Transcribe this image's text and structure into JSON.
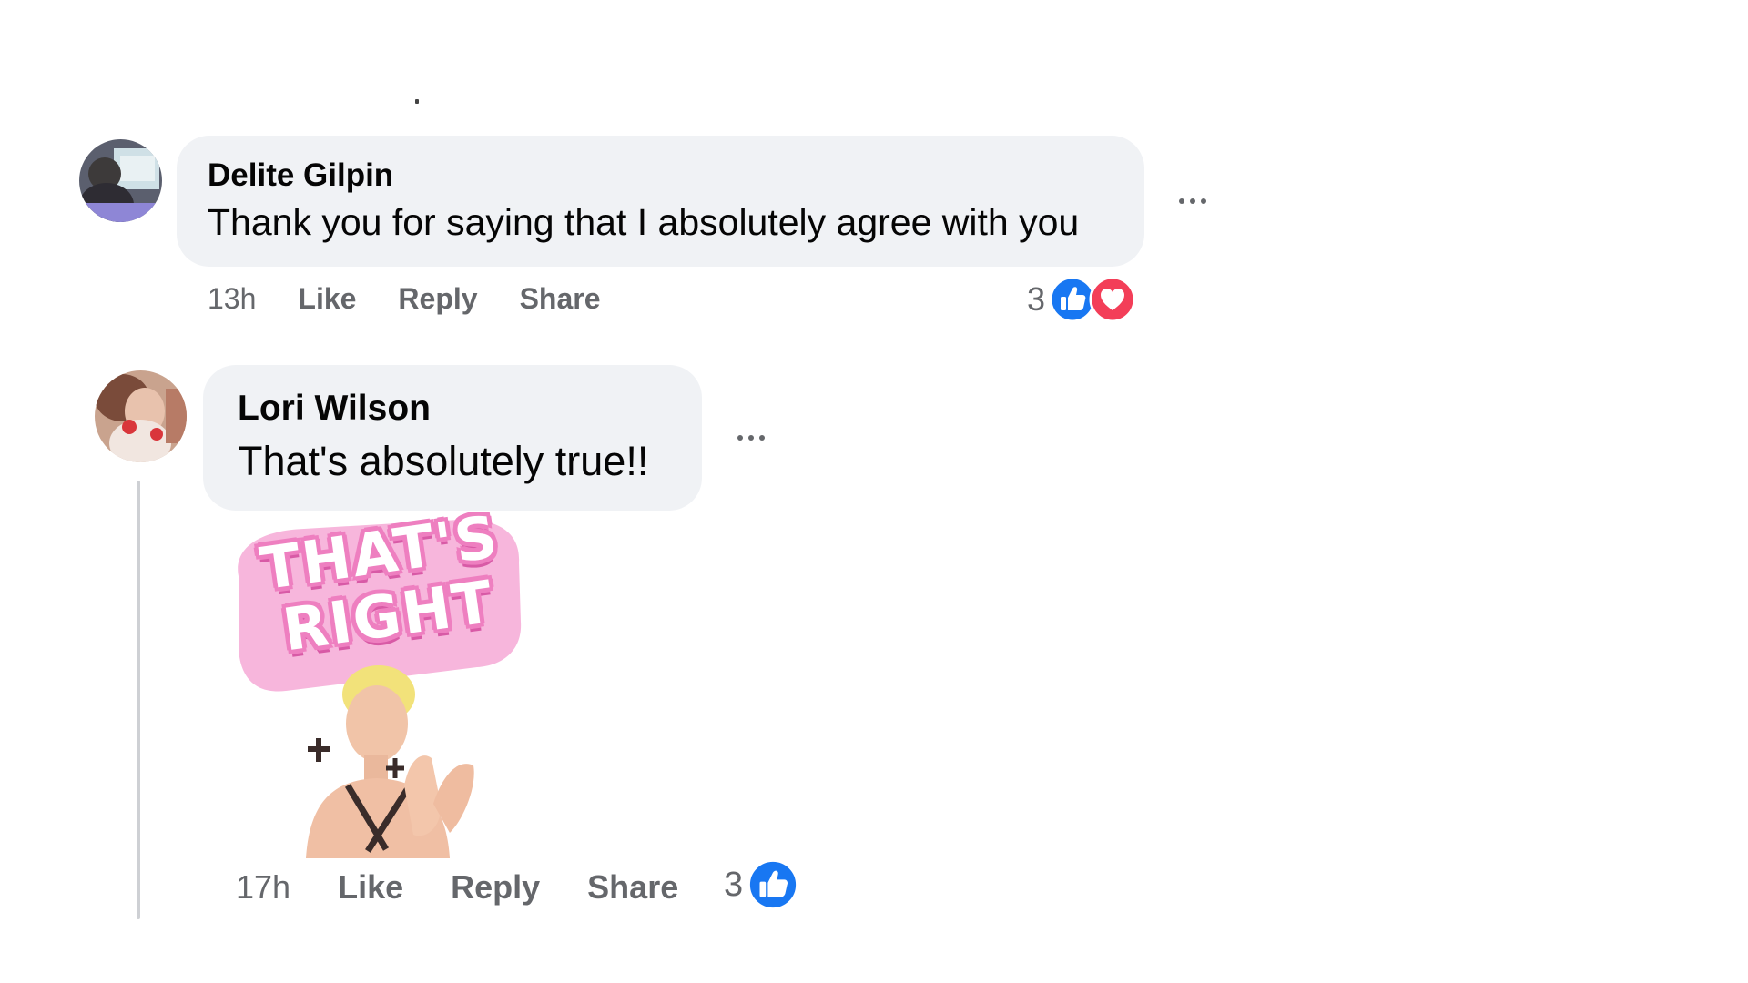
{
  "comments": [
    {
      "author": "Delite Gilpin",
      "text": "Thank you for saying that I absolutely agree with you",
      "time": "13h",
      "actions": {
        "like": "Like",
        "reply": "Reply",
        "share": "Share"
      },
      "reactions": {
        "count": "3",
        "types": [
          "like-icon",
          "love-icon"
        ]
      }
    },
    {
      "author": "Lori Wilson",
      "text": "That's absolutely true!!",
      "sticker_text": "THAT'S RIGHT",
      "time": "17h",
      "actions": {
        "like": "Like",
        "reply": "Reply",
        "share": "Share"
      },
      "reactions": {
        "count": "3",
        "types": [
          "like-icon"
        ]
      }
    }
  ],
  "colors": {
    "bubble": "#f0f2f5",
    "meta_text": "#65676b",
    "like_blue": "#1877f2",
    "love_red": "#f33e58",
    "sticker_pink": "#ee7fc0"
  }
}
